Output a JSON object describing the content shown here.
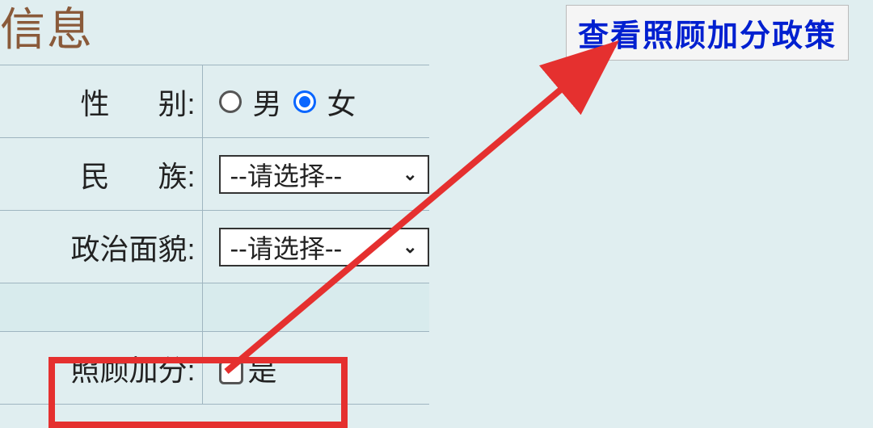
{
  "title": "信息",
  "policy_link": "查看照顾加分政策",
  "rows": {
    "gender": {
      "label": "性",
      "label2": "别:",
      "option_male": "男",
      "option_female": "女",
      "selected": "female"
    },
    "ethnicity": {
      "label": "民",
      "label2": "族:",
      "placeholder": "--请选择--"
    },
    "political": {
      "label": "政治面貌:",
      "placeholder": "--请选择--"
    },
    "bonus": {
      "label": "照顾加分:",
      "option": "是"
    }
  }
}
